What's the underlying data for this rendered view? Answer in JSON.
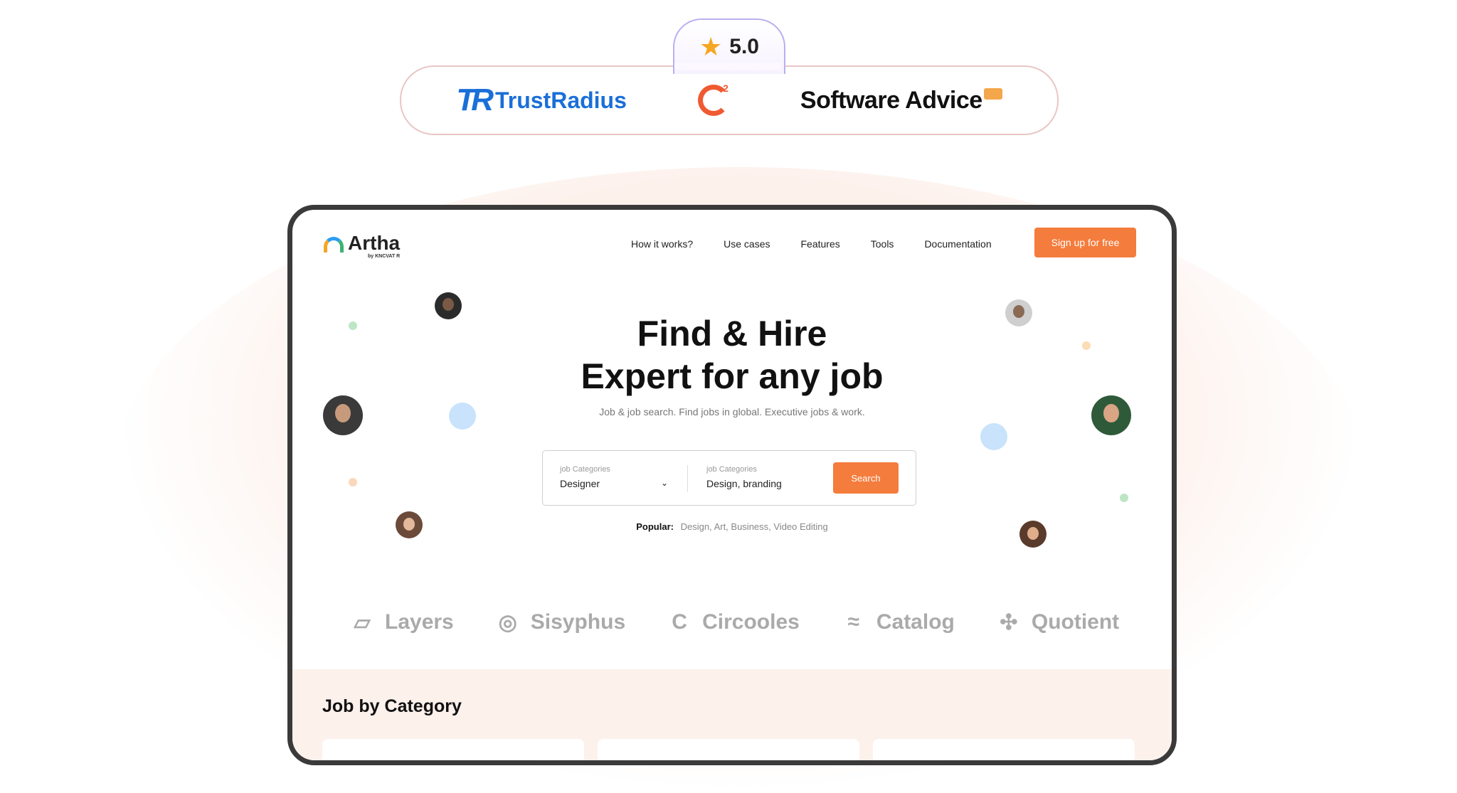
{
  "rating": {
    "score": "5.0",
    "star_icon": "star-icon"
  },
  "review_sites": {
    "trustradius": {
      "mark": "TR",
      "name": "TrustRadius"
    },
    "g2": {
      "mark": "G",
      "superscript": "2"
    },
    "software_advice": {
      "name": "Software Advice"
    }
  },
  "brand": {
    "name": "Artha",
    "sub": "by KNCVAT R"
  },
  "nav": {
    "links": [
      "How it works?",
      "Use cases",
      "Features",
      "Tools",
      "Documentation"
    ],
    "signup_label": "Sign up for free"
  },
  "hero": {
    "title_line1": "Find & Hire",
    "title_line2": "Expert for any job",
    "subtitle": "Job & job search. Find jobs in global. Executive jobs & work."
  },
  "search": {
    "field1": {
      "label": "job Categories",
      "value": "Designer"
    },
    "field2": {
      "label": "job Categories",
      "value": "Design, branding"
    },
    "button_label": "Search"
  },
  "popular": {
    "label": "Popular:",
    "items": "Design, Art, Business, Video Editing"
  },
  "partner_logos": [
    "Layers",
    "Sisyphus",
    "Circooles",
    "Catalog",
    "Quotient"
  ],
  "category_section": {
    "title": "Job by Category"
  },
  "colors": {
    "accent": "#f47c3c",
    "rating_star": "#f5a623",
    "trustradius": "#1a6fd8",
    "g2": "#f05a32"
  }
}
